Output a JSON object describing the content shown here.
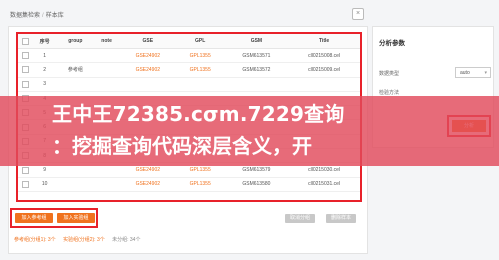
{
  "breadcrumb": [
    "数据集检索",
    "样本库"
  ],
  "close_icon": "×",
  "table": {
    "headers": [
      "序号",
      "group",
      "note",
      "GSE",
      "GPL",
      "GSM",
      "Title"
    ],
    "rows": [
      [
        "1",
        "",
        "",
        "GSE24902",
        "GPL1355",
        "GSM613571",
        "cll0215008.cel"
      ],
      [
        "2",
        "参考组",
        "",
        "GSE24902",
        "GPL1355",
        "GSM613572",
        "cll0215009.cel"
      ],
      [
        "3",
        "",
        "",
        "",
        "",
        "",
        ""
      ],
      [
        "4",
        "",
        "",
        "",
        "",
        "",
        ""
      ],
      [
        "5",
        "",
        "",
        "",
        "",
        "",
        ""
      ],
      [
        "6",
        "",
        "",
        "",
        "",
        "",
        ""
      ],
      [
        "7",
        "",
        "",
        "",
        "",
        "",
        ""
      ],
      [
        "8",
        "",
        "",
        "",
        "",
        "",
        ""
      ],
      [
        "9",
        "",
        "",
        "GSE24902",
        "GPL1355",
        "GSM613579",
        "cll0215030.cel"
      ],
      [
        "10",
        "",
        "",
        "GSE24902",
        "GPL1355",
        "GSM613580",
        "cll0215031.cel"
      ]
    ]
  },
  "buttons": {
    "add_reference": "加入参考组",
    "add_experiment": "加入实验组",
    "cancel_group": "取消分组",
    "delete_sample": "删除样本"
  },
  "stats": {
    "reference": "参考组(分组1): 3个",
    "experiment": "实验组(分组2): 3个",
    "ungrouped": "未分组: 34个"
  },
  "side_panel": {
    "title": "分析参数",
    "group_label": "数据类型",
    "method_label": "检验方法",
    "auto_value": "auto",
    "analyze_button": "分析"
  },
  "banner": {
    "line1": "王中王72385.cσm.7229查询",
    "line2": "：挖掘查询代码深层含义，开"
  },
  "colors": {
    "accent": "#f0721e",
    "frame": "#e8212a",
    "banner": "#e24a5c"
  }
}
